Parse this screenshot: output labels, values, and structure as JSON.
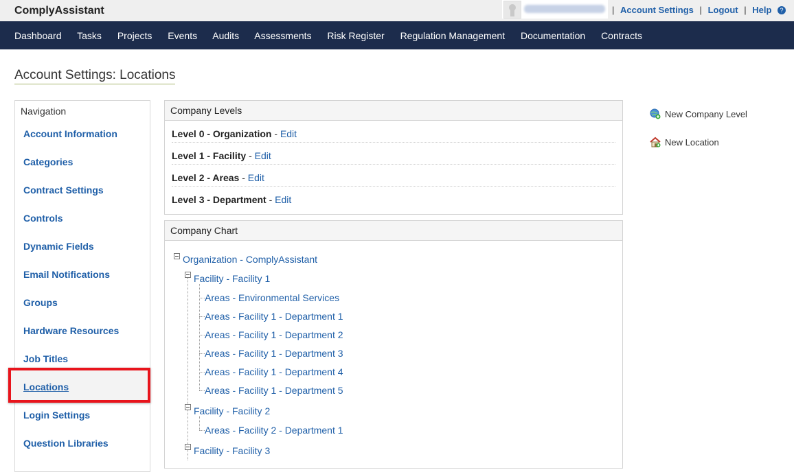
{
  "app": {
    "title": "ComplyAssistant"
  },
  "top_links": {
    "account_settings": "Account Settings",
    "logout": "Logout",
    "help": "Help",
    "separator": "|"
  },
  "main_nav": [
    "Dashboard",
    "Tasks",
    "Projects",
    "Events",
    "Audits",
    "Assessments",
    "Risk Register",
    "Regulation Management",
    "Documentation",
    "Contracts"
  ],
  "page_title": "Account Settings: Locations",
  "sidebar": {
    "header": "Navigation",
    "items": [
      "Account Information",
      "Categories",
      "Contract Settings",
      "Controls",
      "Dynamic Fields",
      "Email Notifications",
      "Groups",
      "Hardware Resources",
      "Job Titles",
      "Locations",
      "Login Settings",
      "Question Libraries"
    ],
    "active": "Locations"
  },
  "company_levels": {
    "title": "Company Levels",
    "dash": "-",
    "edit_label": "Edit",
    "levels": [
      "Level 0 - Organization",
      "Level 1 - Facility",
      "Level 2 - Areas",
      "Level 3 - Department"
    ]
  },
  "company_chart": {
    "title": "Company Chart",
    "root": "Organization - ComplyAssistant",
    "facility1": "Facility - Facility 1",
    "facility1_children": [
      "Areas - Environmental Services",
      "Areas - Facility 1 - Department 1",
      "Areas - Facility 1 - Department 2",
      "Areas - Facility 1 - Department 3",
      "Areas - Facility 1 - Department 4",
      "Areas - Facility 1 - Department 5"
    ],
    "facility2": "Facility - Facility 2",
    "facility2_children": [
      "Areas - Facility 2 - Department 1"
    ],
    "facility3": "Facility - Facility 3"
  },
  "actions": {
    "new_company_level": "New Company Level",
    "new_location": "New Location"
  },
  "icons": {
    "help": "?",
    "new_company_level": "globe-add-icon",
    "new_location": "house-add-icon"
  },
  "colors": {
    "nav_bg": "#1c2c4c",
    "link": "#1f5fa8",
    "highlight": "#e8141c"
  }
}
